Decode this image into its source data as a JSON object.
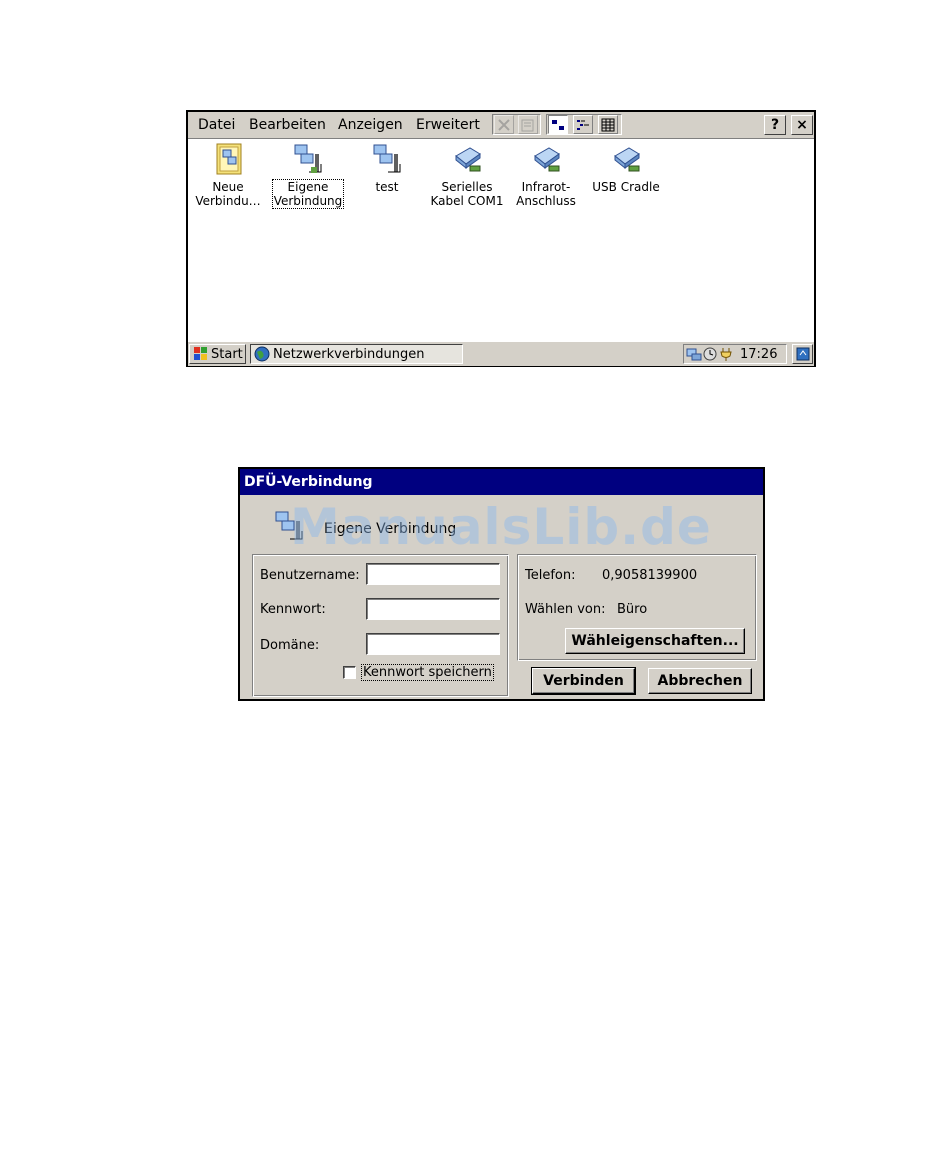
{
  "explorer": {
    "menu": [
      "Datei",
      "Bearbeiten",
      "Anzeigen",
      "Erweitert"
    ],
    "caption_help": "?",
    "caption_close": "×",
    "icons": [
      {
        "label": "Neue\nVerbindu…",
        "icon": "new-connection-icon"
      },
      {
        "label": "Eigene\nVerbindung",
        "icon": "dialup-connection-icon"
      },
      {
        "label": "test",
        "icon": "dialup-connection-icon"
      },
      {
        "label": "Serielles\nKabel COM1",
        "icon": "direct-connection-icon"
      },
      {
        "label": "Infrarot-\nAnschluss",
        "icon": "direct-connection-icon"
      },
      {
        "label": "USB Cradle",
        "icon": "direct-connection-icon"
      }
    ],
    "taskbar": {
      "start_label": "Start",
      "task_label": "Netzwerkverbindungen",
      "clock": "17:26"
    }
  },
  "dialog": {
    "title": "DFÜ-Verbindung",
    "connection_name": "Eigene Verbindung",
    "username_label": "Benutzername:",
    "username_value": "",
    "password_label": "Kennwort:",
    "password_value": "",
    "domain_label": "Domäne:",
    "domain_value": "",
    "save_password_label": "Kennwort speichern",
    "save_password_checked": false,
    "phone_label": "Telefon:",
    "phone_value": "0,9058139900",
    "dial_from_label": "Wählen von:",
    "dial_from_value": "Büro",
    "dial_properties_button": "Wähleigenschaften...",
    "connect_button": "Verbinden",
    "cancel_button": "Abbrechen"
  },
  "watermark": "ManualsLib.de",
  "colors": {
    "titlebar": "#000080",
    "face": "#d4d0c8"
  }
}
